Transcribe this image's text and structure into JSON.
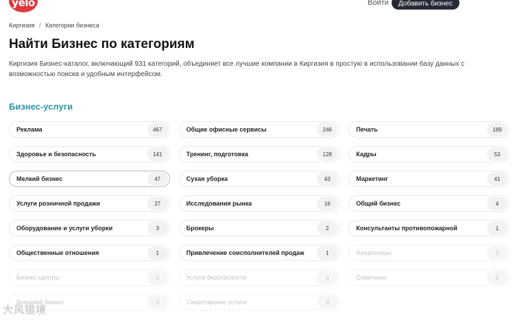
{
  "header": {
    "logo_text": "yelo",
    "login_label": "Войти",
    "add_business_label": "Добавить бизнес"
  },
  "breadcrumb": [
    "Киргизия",
    "Категории бизнеса"
  ],
  "breadcrumb_sep": "/",
  "page": {
    "title": "Найти Бизнес по категориям",
    "description": "Киргизия Бизнес-каталог, включающий 931 категорий, объединяет все лучшие компании в Киргизия в простую в использовании базу данных с возможностью поиска и удобным интерфейсом."
  },
  "section": {
    "title": "Бизнес-услуги"
  },
  "categories": [
    {
      "name": "Реклама",
      "count": "467"
    },
    {
      "name": "Общие офисные сервисы",
      "count": "246"
    },
    {
      "name": "Печать",
      "count": "189"
    },
    {
      "name": "Здоровье и безопасность",
      "count": "141"
    },
    {
      "name": "Тренинг, подготовка",
      "count": "128"
    },
    {
      "name": "Кадры",
      "count": "53"
    },
    {
      "name": "Мелкий бизнес",
      "count": "47"
    },
    {
      "name": "Сухая уборка",
      "count": "43"
    },
    {
      "name": "Маркетинг",
      "count": "41"
    },
    {
      "name": "Услуги розничной продажи",
      "count": "27"
    },
    {
      "name": "Исследования рынка",
      "count": "16"
    },
    {
      "name": "Общий бизнес",
      "count": "4"
    },
    {
      "name": "Оборудование и услуги уборки",
      "count": "3"
    },
    {
      "name": "Брокеры",
      "count": "2"
    },
    {
      "name": "Консультанты противопожарной",
      "count": "1"
    },
    {
      "name": "Общественные отношения",
      "count": "1"
    },
    {
      "name": "Привлечение соисполнителей продаж",
      "count": "1"
    },
    {
      "name": "Аукционеры",
      "count": "0"
    },
    {
      "name": "Бизнес-центры",
      "count": "0"
    },
    {
      "name": "Услуги безопасности",
      "count": "0"
    },
    {
      "name": "Советники",
      "count": "0"
    },
    {
      "name": "Внешний бизнес",
      "count": "0"
    },
    {
      "name": "Секретарские услуги",
      "count": "0"
    }
  ],
  "watermark": "大风猎境"
}
